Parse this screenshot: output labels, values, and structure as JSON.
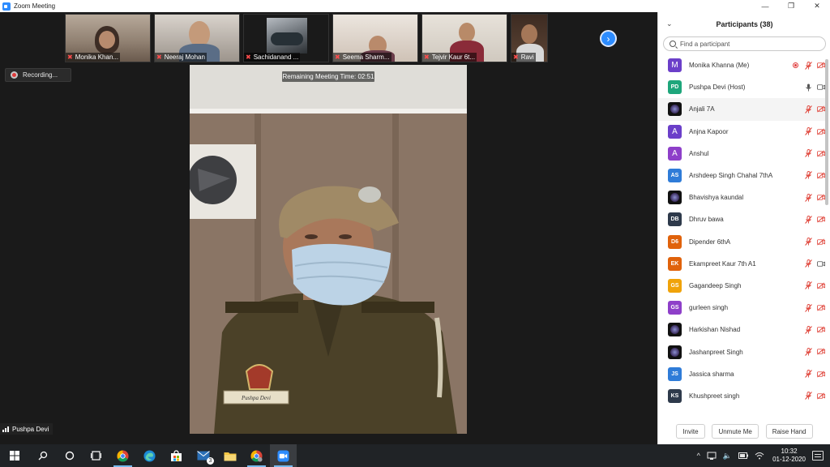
{
  "window": {
    "title": "Zoom Meeting",
    "controls": [
      "—",
      "❐",
      "✕"
    ]
  },
  "gallery": {
    "participants": [
      {
        "name": "Monika Khan...",
        "muted": true
      },
      {
        "name": "Neeraj Mohan",
        "muted": true
      },
      {
        "name": "Sachidanand ...",
        "muted": true
      },
      {
        "name": "Seema Sharm...",
        "muted": true
      },
      {
        "name": "Tejvir Kaur 6t...",
        "muted": true
      },
      {
        "name": "Ravi",
        "muted": true
      }
    ],
    "next_icon": "chevron-right-icon"
  },
  "recording": {
    "label": "Recording..."
  },
  "main_video": {
    "remaining_time": "Remaining Meeting Time: 02:51",
    "speaker_name": "Pushpa Devi",
    "name_tag": "Pushpa Devi"
  },
  "participants_panel": {
    "title": "Participants (38)",
    "search_placeholder": "Find a participant",
    "participants": [
      {
        "name": "Monika Khanna (Me)",
        "initials": "M",
        "color": "#6b3fc9",
        "avatar": "letter",
        "mic": "muted",
        "video": "off",
        "recording": true
      },
      {
        "name": "Pushpa Devi (Host)",
        "initials": "PD",
        "color": "#1ea67b",
        "avatar": "letter",
        "mic": "on",
        "video": "on"
      },
      {
        "name": "Anjali 7A",
        "initials": "",
        "color": "#000000",
        "avatar": "photo",
        "mic": "muted",
        "video": "off"
      },
      {
        "name": "Anjna Kapoor",
        "initials": "A",
        "color": "#6b3fc9",
        "avatar": "letter",
        "mic": "muted",
        "video": "off"
      },
      {
        "name": "Anshul",
        "initials": "A",
        "color": "#8e3fc9",
        "avatar": "letter",
        "mic": "muted",
        "video": "off"
      },
      {
        "name": "Arshdeep Singh Chahal 7thA",
        "initials": "AS",
        "color": "#2f7cd8",
        "avatar": "letter",
        "mic": "muted",
        "video": "off"
      },
      {
        "name": "Bhavishya kaundal",
        "initials": "",
        "color": "#000000",
        "avatar": "photo",
        "mic": "muted",
        "video": "off"
      },
      {
        "name": "Dhruv bawa",
        "initials": "DB",
        "color": "#2e3a4b",
        "avatar": "letter",
        "mic": "muted",
        "video": "off"
      },
      {
        "name": "Dipender 6thA",
        "initials": "D6",
        "color": "#e0620b",
        "avatar": "letter",
        "mic": "muted",
        "video": "off"
      },
      {
        "name": "Ekampreet Kaur 7th A1",
        "initials": "EK",
        "color": "#e0620b",
        "avatar": "letter",
        "mic": "muted",
        "video": "on"
      },
      {
        "name": "Gagandeep Singh",
        "initials": "GS",
        "color": "#f0a30a",
        "avatar": "letter",
        "mic": "muted",
        "video": "off"
      },
      {
        "name": "gurleen singh",
        "initials": "GS",
        "color": "#8e3fc9",
        "avatar": "letter",
        "mic": "muted",
        "video": "off"
      },
      {
        "name": "Harkishan Nishad",
        "initials": "",
        "color": "#000000",
        "avatar": "photo",
        "mic": "muted",
        "video": "off"
      },
      {
        "name": "Jashanpreet Singh",
        "initials": "",
        "color": "#000000",
        "avatar": "photo",
        "mic": "muted",
        "video": "off"
      },
      {
        "name": "Jassica sharma",
        "initials": "JS",
        "color": "#2f7cd8",
        "avatar": "letter",
        "mic": "muted",
        "video": "off"
      },
      {
        "name": "Khushpreet singh",
        "initials": "KS",
        "color": "#2e3a4b",
        "avatar": "letter",
        "mic": "muted",
        "video": "off"
      }
    ],
    "footer_buttons": [
      "Invite",
      "Unmute Me",
      "Raise Hand"
    ]
  },
  "taskbar": {
    "icons": [
      "windows-icon",
      "search-icon",
      "cortana-icon",
      "task-view-icon",
      "chrome-icon",
      "edge-icon",
      "store-icon",
      "mail-icon",
      "file-explorer-icon",
      "chrome-profile-icon",
      "zoom-icon"
    ],
    "mail_badge": "3",
    "time": "10:32",
    "date": "01-12-2020"
  }
}
